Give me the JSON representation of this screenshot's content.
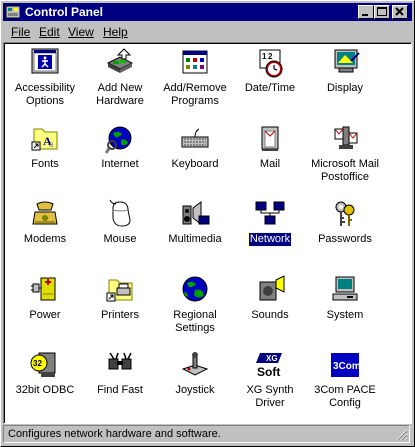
{
  "window": {
    "title": "Control Panel"
  },
  "menu": [
    {
      "label": "File"
    },
    {
      "label": "Edit"
    },
    {
      "label": "View"
    },
    {
      "label": "Help"
    }
  ],
  "icons": [
    {
      "label": "Accessibility\nOptions",
      "icon": "accessibility-icon"
    },
    {
      "label": "Add New\nHardware",
      "icon": "add-hardware-icon"
    },
    {
      "label": "Add/Remove\nPrograms",
      "icon": "add-remove-programs-icon"
    },
    {
      "label": "Date/Time",
      "icon": "date-time-icon"
    },
    {
      "label": "Display",
      "icon": "display-icon"
    },
    {
      "label": "Fonts",
      "icon": "fonts-icon"
    },
    {
      "label": "Internet",
      "icon": "internet-icon"
    },
    {
      "label": "Keyboard",
      "icon": "keyboard-icon"
    },
    {
      "label": "Mail",
      "icon": "mail-icon"
    },
    {
      "label": "Microsoft Mail\nPostoffice",
      "icon": "ms-mail-postoffice-icon"
    },
    {
      "label": "Modems",
      "icon": "modems-icon"
    },
    {
      "label": "Mouse",
      "icon": "mouse-icon"
    },
    {
      "label": "Multimedia",
      "icon": "multimedia-icon"
    },
    {
      "label": "Network",
      "icon": "network-icon",
      "selected": true
    },
    {
      "label": "Passwords",
      "icon": "passwords-icon"
    },
    {
      "label": "Power",
      "icon": "power-icon"
    },
    {
      "label": "Printers",
      "icon": "printers-icon"
    },
    {
      "label": "Regional\nSettings",
      "icon": "regional-settings-icon"
    },
    {
      "label": "Sounds",
      "icon": "sounds-icon"
    },
    {
      "label": "System",
      "icon": "system-icon"
    },
    {
      "label": "32bit ODBC",
      "icon": "odbc-icon"
    },
    {
      "label": "Find Fast",
      "icon": "find-fast-icon"
    },
    {
      "label": "Joystick",
      "icon": "joystick-icon"
    },
    {
      "label": "XG Synth\nDriver",
      "icon": "xg-synth-icon"
    },
    {
      "label": "3Com PACE\nConfig",
      "icon": "3com-pace-icon"
    }
  ],
  "status": {
    "text": "Configures network hardware and software."
  }
}
